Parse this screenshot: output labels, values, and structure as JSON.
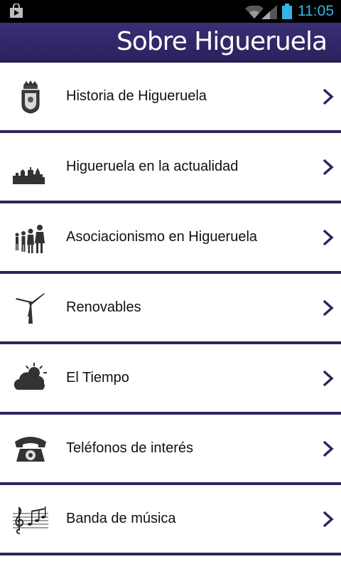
{
  "status_bar": {
    "time": "11:05",
    "left_icon": "store-icon",
    "wifi_icon": "wifi-icon",
    "signal_icon": "signal-icon",
    "battery_icon": "battery-icon",
    "time_color": "#33b5e5"
  },
  "header": {
    "title": "Sobre Higueruela",
    "background": "#2f2666"
  },
  "menu": {
    "items": [
      {
        "label": "Historia de Higueruela",
        "icon": "coat-of-arms-icon"
      },
      {
        "label": "Higueruela en la actualidad",
        "icon": "town-skyline-icon"
      },
      {
        "label": "Asociacionismo en Higueruela",
        "icon": "people-icon"
      },
      {
        "label": "Renovables",
        "icon": "wind-turbine-icon"
      },
      {
        "label": "El Tiempo",
        "icon": "weather-icon"
      },
      {
        "label": "Teléfonos de interés",
        "icon": "telephone-icon"
      },
      {
        "label": "Banda de música",
        "icon": "music-staff-icon"
      }
    ],
    "chevron_icon": "chevron-right-icon",
    "divider_color": "#2b2660"
  }
}
